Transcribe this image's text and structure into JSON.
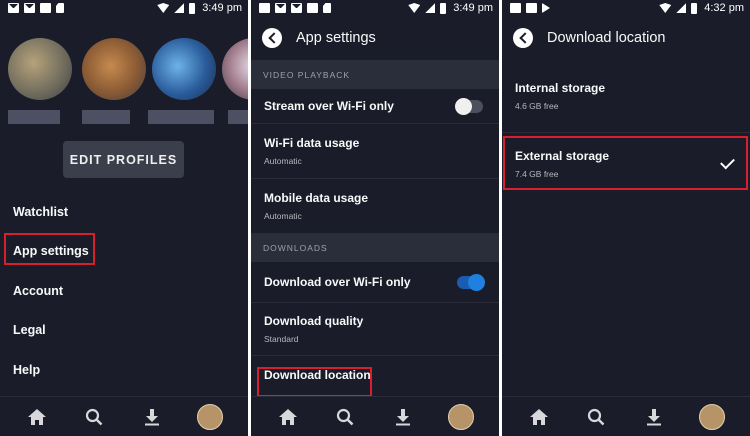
{
  "status_bars": [
    {
      "time": "3:49 pm",
      "icons": [
        "mail-icon",
        "mail-icon",
        "image-icon",
        "sd-card-icon"
      ]
    },
    {
      "time": "3:49 pm",
      "icons": [
        "image-icon",
        "mail-icon",
        "mail-icon",
        "image-icon",
        "sd-card-icon"
      ]
    },
    {
      "time": "4:32 pm",
      "icons": [
        "image-icon",
        "image-icon",
        "play-icon"
      ]
    }
  ],
  "profiles_screen": {
    "edit_profiles": "EDIT PROFILES",
    "menu": [
      "Watchlist",
      "App settings",
      "Account",
      "Legal",
      "Help"
    ],
    "highlighted": "App settings"
  },
  "app_settings": {
    "title": "App settings",
    "sections": [
      {
        "header": "VIDEO PLAYBACK",
        "rows": [
          {
            "label": "Stream over Wi-Fi only",
            "toggle": "off"
          },
          {
            "label": "Wi-Fi data usage",
            "sub": "Automatic"
          },
          {
            "label": "Mobile data usage",
            "sub": "Automatic"
          }
        ]
      },
      {
        "header": "DOWNLOADS",
        "rows": [
          {
            "label": "Download over Wi-Fi only",
            "toggle": "on"
          },
          {
            "label": "Download quality",
            "sub": "Standard"
          },
          {
            "label": "Download location"
          }
        ]
      }
    ],
    "highlighted": "Download location"
  },
  "download_location": {
    "title": "Download location",
    "options": [
      {
        "label": "Internal storage",
        "sub": "4.6 GB free",
        "selected": false
      },
      {
        "label": "External storage",
        "sub": "7.4 GB free",
        "selected": true
      }
    ],
    "highlighted": "External storage"
  },
  "bottom_nav": [
    "home-icon",
    "search-icon",
    "download-icon",
    "profile-avatar"
  ],
  "colors": {
    "background": "#1a1d29",
    "section": "#2a2d3a",
    "highlight": "#d6202e",
    "toggle_on": "#1f80e0"
  }
}
